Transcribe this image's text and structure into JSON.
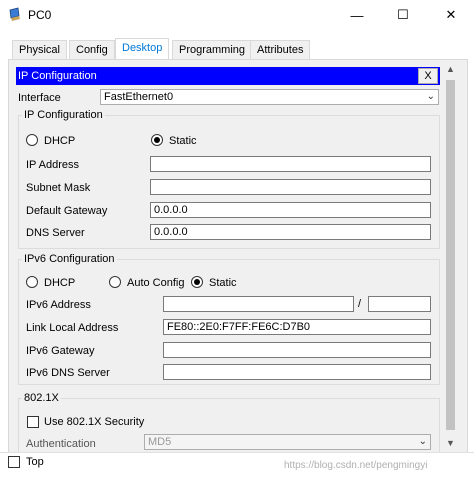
{
  "window": {
    "title": "PC0",
    "minimize_glyph": "—",
    "maximize_glyph": "☐",
    "close_glyph": "✕"
  },
  "tabs": [
    {
      "label": "Physical"
    },
    {
      "label": "Config"
    },
    {
      "label": "Desktop"
    },
    {
      "label": "Programming"
    },
    {
      "label": "Attributes"
    }
  ],
  "active_tab": "Desktop",
  "ip_config": {
    "header": "IP Configuration",
    "close_label": "X",
    "interface_label": "Interface",
    "interface_value": "FastEthernet0",
    "ipv4": {
      "group_title": "IP Configuration",
      "dhcp_label": "DHCP",
      "static_label": "Static",
      "selected": "Static",
      "ip_address_label": "IP Address",
      "ip_address_value": "",
      "subnet_mask_label": "Subnet Mask",
      "subnet_mask_value": "",
      "default_gateway_label": "Default Gateway",
      "default_gateway_value": "0.0.0.0",
      "dns_server_label": "DNS Server",
      "dns_server_value": "0.0.0.0"
    },
    "ipv6": {
      "group_title": "IPv6 Configuration",
      "dhcp_label": "DHCP",
      "auto_config_label": "Auto Config",
      "static_label": "Static",
      "selected": "Static",
      "ipv6_address_label": "IPv6 Address",
      "ipv6_address_value": "",
      "prefix_separator": "/",
      "prefix_value": "",
      "link_local_label": "Link Local Address",
      "link_local_value": "FE80::2E0:F7FF:FE6C:D7B0",
      "ipv6_gateway_label": "IPv6 Gateway",
      "ipv6_gateway_value": "",
      "ipv6_dns_label": "IPv6 DNS Server",
      "ipv6_dns_value": ""
    },
    "dot1x": {
      "group_title": "802.1X",
      "use_label": "Use 802.1X Security",
      "use_checked": false,
      "auth_label": "Authentication",
      "auth_value": "MD5"
    }
  },
  "bottom": {
    "top_label": "Top",
    "top_checked": false,
    "watermark": "https://blog.csdn.net/pengmingyi"
  },
  "colors": {
    "header_bg": "#0000ff",
    "active_tab": "#0078d7"
  }
}
